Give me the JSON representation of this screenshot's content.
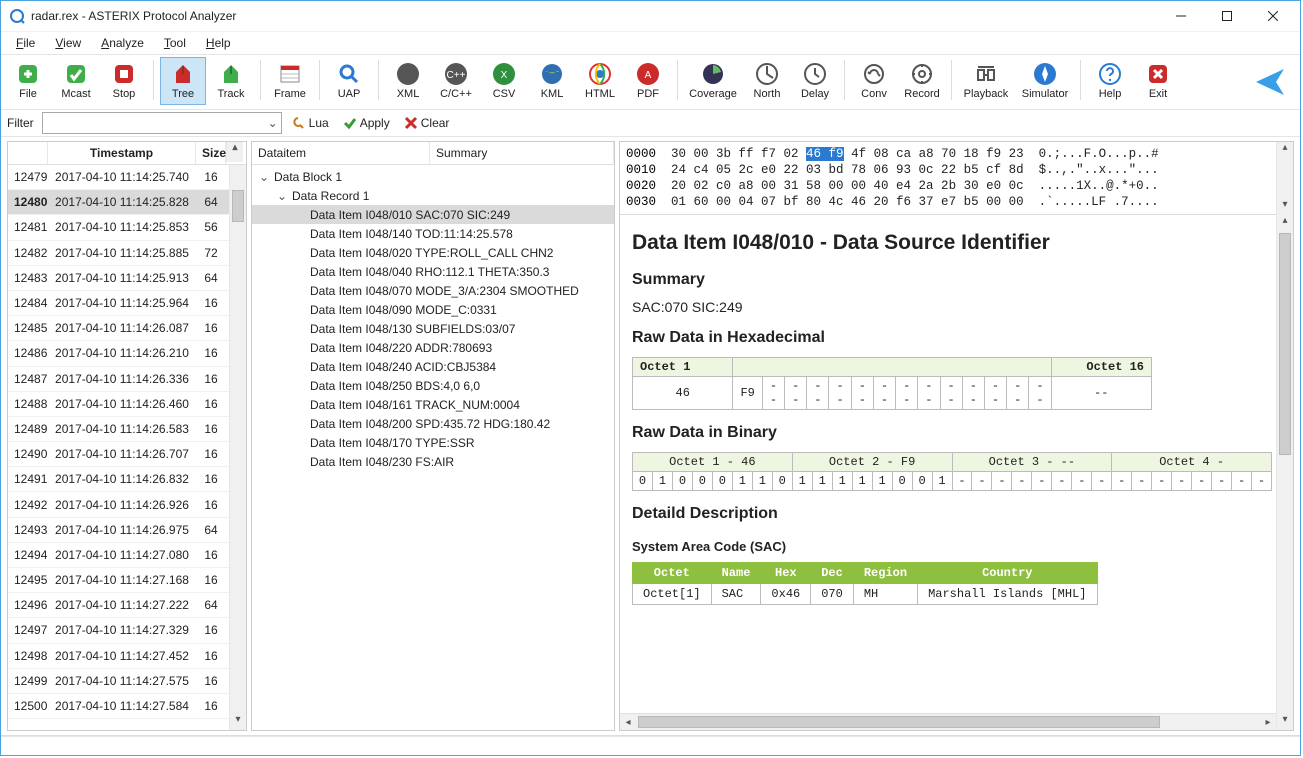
{
  "title": "radar.rex - ASTERIX Protocol Analyzer",
  "menus": [
    "File",
    "View",
    "Analyze",
    "Tool",
    "Help"
  ],
  "toolbar": [
    {
      "k": "file",
      "label": "File"
    },
    {
      "k": "mcast",
      "label": "Mcast"
    },
    {
      "k": "stop",
      "label": "Stop"
    },
    {
      "sep": true
    },
    {
      "k": "tree",
      "label": "Tree",
      "sel": true
    },
    {
      "k": "track",
      "label": "Track"
    },
    {
      "sep": true
    },
    {
      "k": "frame",
      "label": "Frame"
    },
    {
      "sep": true
    },
    {
      "k": "uap",
      "label": "UAP"
    },
    {
      "sep": true
    },
    {
      "k": "xml",
      "label": "XML"
    },
    {
      "k": "cpp",
      "label": "C/C++"
    },
    {
      "k": "csv",
      "label": "CSV"
    },
    {
      "k": "kml",
      "label": "KML"
    },
    {
      "k": "html",
      "label": "HTML"
    },
    {
      "k": "pdf",
      "label": "PDF"
    },
    {
      "sep": true
    },
    {
      "k": "cov",
      "label": "Coverage"
    },
    {
      "k": "north",
      "label": "North"
    },
    {
      "k": "delay",
      "label": "Delay"
    },
    {
      "sep": true
    },
    {
      "k": "conv",
      "label": "Conv"
    },
    {
      "k": "record",
      "label": "Record"
    },
    {
      "sep": true
    },
    {
      "k": "play",
      "label": "Playback"
    },
    {
      "k": "sim",
      "label": "Simulator"
    },
    {
      "sep": true
    },
    {
      "k": "help",
      "label": "Help"
    },
    {
      "k": "exit",
      "label": "Exit"
    }
  ],
  "filter": {
    "label": "Filter",
    "lua": "Lua",
    "apply": "Apply",
    "clear": "Clear"
  },
  "list": {
    "headers": {
      "ts": "Timestamp",
      "sz": "Size"
    },
    "rows": [
      {
        "idx": "12479",
        "ts": "2017-04-10 11:14:25.740",
        "sz": "16"
      },
      {
        "idx": "12480",
        "ts": "2017-04-10 11:14:25.828",
        "sz": "64",
        "sel": true
      },
      {
        "idx": "12481",
        "ts": "2017-04-10 11:14:25.853",
        "sz": "56"
      },
      {
        "idx": "12482",
        "ts": "2017-04-10 11:14:25.885",
        "sz": "72"
      },
      {
        "idx": "12483",
        "ts": "2017-04-10 11:14:25.913",
        "sz": "64"
      },
      {
        "idx": "12484",
        "ts": "2017-04-10 11:14:25.964",
        "sz": "16"
      },
      {
        "idx": "12485",
        "ts": "2017-04-10 11:14:26.087",
        "sz": "16"
      },
      {
        "idx": "12486",
        "ts": "2017-04-10 11:14:26.210",
        "sz": "16"
      },
      {
        "idx": "12487",
        "ts": "2017-04-10 11:14:26.336",
        "sz": "16"
      },
      {
        "idx": "12488",
        "ts": "2017-04-10 11:14:26.460",
        "sz": "16"
      },
      {
        "idx": "12489",
        "ts": "2017-04-10 11:14:26.583",
        "sz": "16"
      },
      {
        "idx": "12490",
        "ts": "2017-04-10 11:14:26.707",
        "sz": "16"
      },
      {
        "idx": "12491",
        "ts": "2017-04-10 11:14:26.832",
        "sz": "16"
      },
      {
        "idx": "12492",
        "ts": "2017-04-10 11:14:26.926",
        "sz": "16"
      },
      {
        "idx": "12493",
        "ts": "2017-04-10 11:14:26.975",
        "sz": "64"
      },
      {
        "idx": "12494",
        "ts": "2017-04-10 11:14:27.080",
        "sz": "16"
      },
      {
        "idx": "12495",
        "ts": "2017-04-10 11:14:27.168",
        "sz": "16"
      },
      {
        "idx": "12496",
        "ts": "2017-04-10 11:14:27.222",
        "sz": "64"
      },
      {
        "idx": "12497",
        "ts": "2017-04-10 11:14:27.329",
        "sz": "16"
      },
      {
        "idx": "12498",
        "ts": "2017-04-10 11:14:27.452",
        "sz": "16"
      },
      {
        "idx": "12499",
        "ts": "2017-04-10 11:14:27.575",
        "sz": "16"
      },
      {
        "idx": "12500",
        "ts": "2017-04-10 11:14:27.584",
        "sz": "16"
      }
    ]
  },
  "tree": {
    "headers": {
      "di": "Dataitem",
      "sum": "Summary"
    },
    "block": "Data Block 1",
    "record": "Data Record 1",
    "items": [
      {
        "t": "Data Item I048/010  SAC:070 SIC:249",
        "sel": true
      },
      {
        "t": "Data Item I048/140  TOD:11:14:25.578"
      },
      {
        "t": "Data Item I048/020  TYPE:ROLL_CALL CHN2"
      },
      {
        "t": "Data Item I048/040  RHO:112.1 THETA:350.3"
      },
      {
        "t": "Data Item I048/070  MODE_3/A:2304 SMOOTHED"
      },
      {
        "t": "Data Item I048/090  MODE_C:0331"
      },
      {
        "t": "Data Item I048/130  SUBFIELDS:03/07"
      },
      {
        "t": "Data Item I048/220  ADDR:780693"
      },
      {
        "t": "Data Item I048/240  ACID:CBJ5384"
      },
      {
        "t": "Data Item I048/250  BDS:4,0 6,0"
      },
      {
        "t": "Data Item I048/161  TRACK_NUM:0004"
      },
      {
        "t": "Data Item I048/200  SPD:435.72 HDG:180.42"
      },
      {
        "t": "Data Item I048/170  TYPE:SSR"
      },
      {
        "t": "Data Item I048/230  FS:AIR"
      }
    ]
  },
  "hex": {
    "lines": [
      {
        "off": "0000",
        "b": "30 00 3b ff f7 02 ",
        "hi": "46 f9",
        "a": " 4f 08 ca a8 70 18 f9 23",
        "t": "  0.;...F.O...p..#"
      },
      {
        "off": "0010",
        "b": "24 c4 05 2c e0 22 03 bd 78 06 93 0c 22 b5 cf 8d",
        "t": "  $..,.\"..x...\"..."
      },
      {
        "off": "0020",
        "b": "20 02 c0 a8 00 31 58 00 00 40 e4 2a 2b 30 e0 0c",
        "t": "  .....1X..@.*+0.."
      },
      {
        "off": "0030",
        "b": "01 60 00 04 07 bf 80 4c 46 20 f6 37 e7 b5 00 00",
        "t": "  .`.....LF .7...."
      }
    ]
  },
  "detail": {
    "h1": "Data Item I048/010 - Data Source Identifier",
    "h2a": "Summary",
    "p1": "SAC:070 SIC:249",
    "h2b": "Raw Data in Hexadecimal",
    "oct1": "Octet 1",
    "oct16": "Octet 16",
    "hexrow": [
      "46",
      "F9",
      "--",
      "--",
      "--",
      "--",
      "--",
      "--",
      "--",
      "--",
      "--",
      "--",
      "--",
      "--",
      "--",
      "--"
    ],
    "h2c": "Raw Data in Binary",
    "binhdr": [
      "Octet 1 - 46",
      "Octet 2 - F9",
      "Octet 3 - --",
      "Octet 4 -"
    ],
    "bits": [
      "0",
      "1",
      "0",
      "0",
      "0",
      "1",
      "1",
      "0",
      "1",
      "1",
      "1",
      "1",
      "1",
      "0",
      "0",
      "1",
      "-",
      "-",
      "-",
      "-",
      "-",
      "-",
      "-",
      "-",
      "-",
      "-",
      "-",
      "-",
      "-",
      "-",
      "-",
      "-"
    ],
    "h2d": "Detaild Description",
    "h3a": "System Area Code (SAC)",
    "sac": {
      "hdr": [
        "Octet",
        "Name",
        "Hex",
        "Dec",
        "Region",
        "Country"
      ],
      "row": [
        "Octet[1]",
        "SAC",
        "0x46",
        "070",
        "MH",
        "Marshall Islands [MHL]"
      ]
    }
  }
}
